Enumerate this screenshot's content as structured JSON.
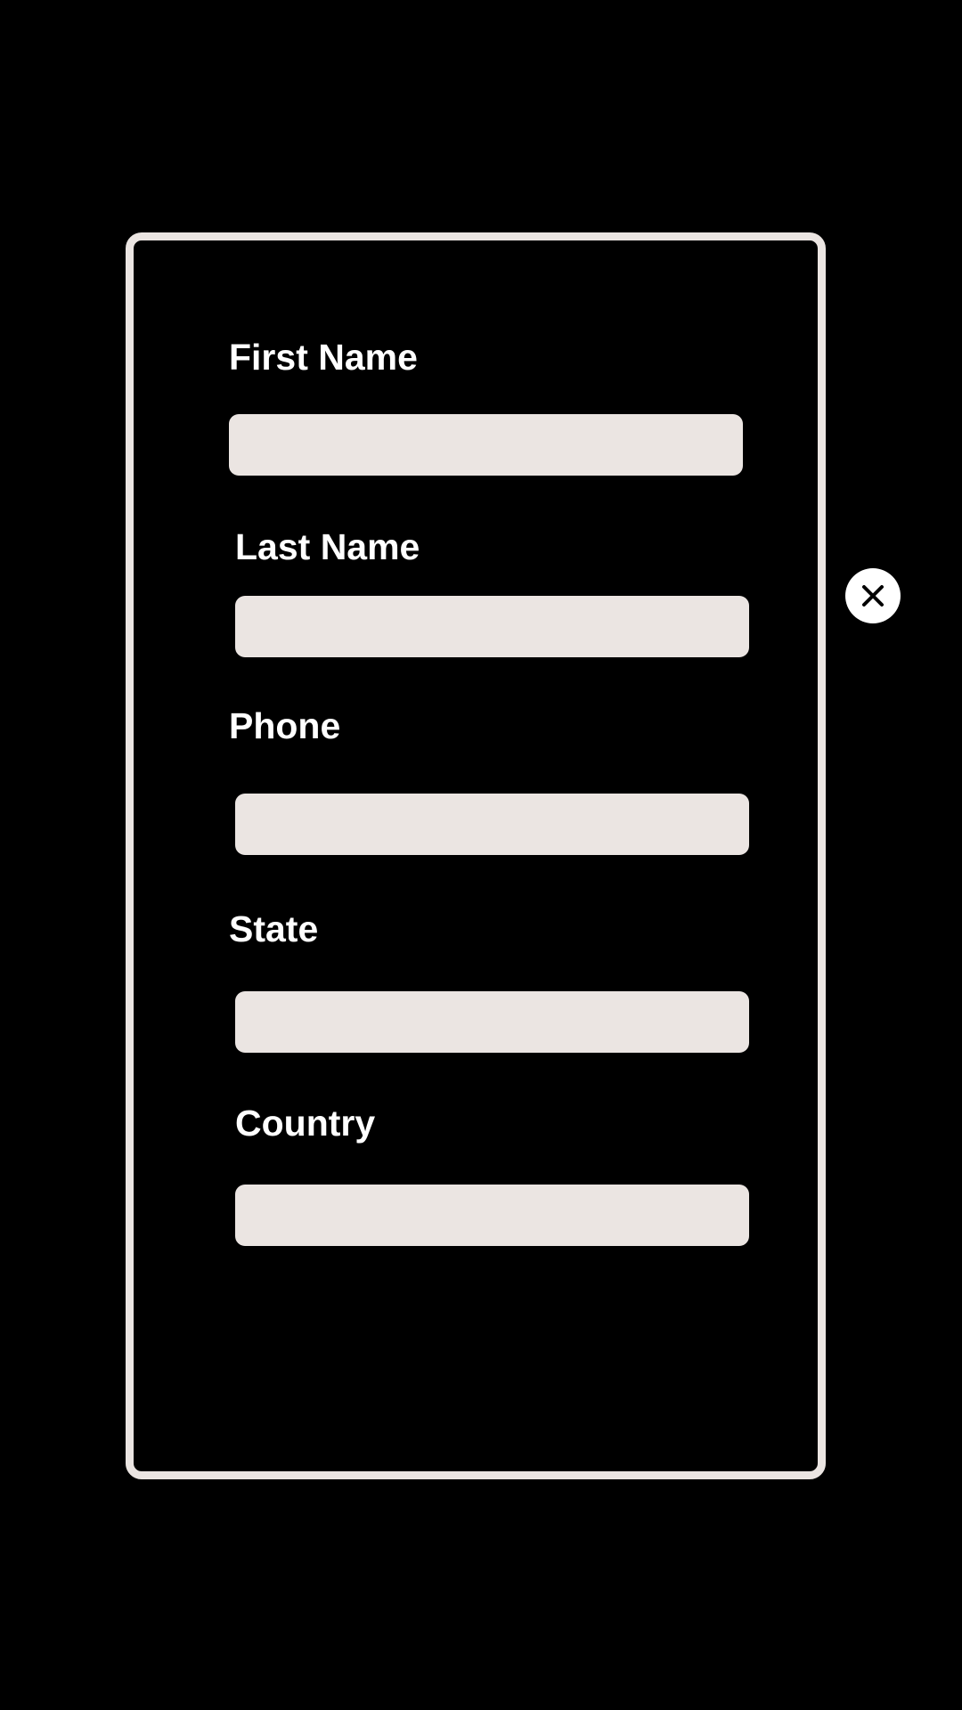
{
  "form": {
    "fields": [
      {
        "label": "First Name",
        "value": "",
        "placeholder": ""
      },
      {
        "label": "Last Name",
        "value": "",
        "placeholder": ""
      },
      {
        "label": "Phone",
        "value": "",
        "placeholder": ""
      },
      {
        "label": "State",
        "value": "",
        "placeholder": ""
      },
      {
        "label": "Country",
        "value": "",
        "placeholder": ""
      }
    ]
  },
  "close_button": {
    "icon": "close-icon"
  },
  "colors": {
    "background": "#000000",
    "card_border": "#ebe5e2",
    "input_fill": "#ebe5e2",
    "label_text": "#ffffff",
    "close_button_fill": "#ffffff",
    "close_icon": "#000000"
  }
}
